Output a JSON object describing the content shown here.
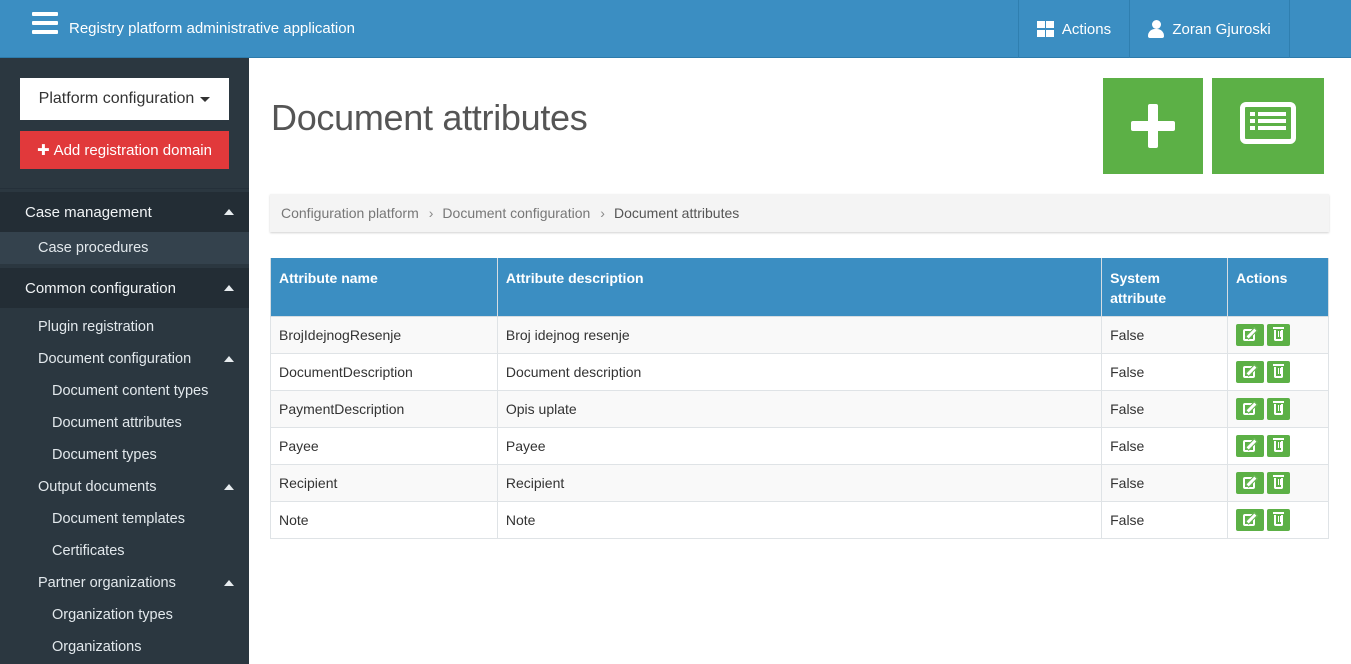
{
  "header": {
    "app_title": "Registry platform administrative application",
    "actions_label": "Actions",
    "user_name": "Zoran Gjuroski"
  },
  "sidebar": {
    "platform_select": "Platform configuration",
    "add_domain": "Add registration domain",
    "items": [
      {
        "label": "Case management",
        "level": 1,
        "expanded": true
      },
      {
        "label": "Case procedures",
        "level": 2
      },
      {
        "label": "Common configuration",
        "level": 1,
        "expanded": true
      },
      {
        "label": "Plugin registration",
        "level": 2
      },
      {
        "label": "Document configuration",
        "level": 2,
        "expanded": true
      },
      {
        "label": "Document content types",
        "level": 3
      },
      {
        "label": "Document attributes",
        "level": 3
      },
      {
        "label": "Document types",
        "level": 3
      },
      {
        "label": "Output documents",
        "level": 2,
        "expanded": true
      },
      {
        "label": "Document templates",
        "level": 3
      },
      {
        "label": "Certificates",
        "level": 3
      },
      {
        "label": "Partner organizations",
        "level": 2,
        "expanded": true
      },
      {
        "label": "Organization types",
        "level": 3
      },
      {
        "label": "Organizations",
        "level": 3
      }
    ]
  },
  "main": {
    "page_title": "Document attributes",
    "breadcrumb": [
      "Configuration platform",
      "Document configuration",
      "Document attributes"
    ],
    "table": {
      "headers": [
        "Attribute name",
        "Attribute description",
        "System attribute",
        "Actions"
      ],
      "rows": [
        [
          "BrojIdejnogResenje",
          "Broj idejnog resenje",
          "False"
        ],
        [
          "DocumentDescription",
          "Document description",
          "False"
        ],
        [
          "PaymentDescription",
          "Opis uplate",
          "False"
        ],
        [
          "Payee",
          "Payee",
          "False"
        ],
        [
          "Recipient",
          "Recipient",
          "False"
        ],
        [
          "Note",
          "Note",
          "False"
        ]
      ]
    }
  },
  "colors": {
    "topbar": "#3b8ec2",
    "sidebar": "#2b3740",
    "accent_green": "#5cb046",
    "accent_red": "#e1393b"
  },
  "icons": [
    "menu-icon",
    "grid-icon",
    "user-icon",
    "plus-icon",
    "list-icon",
    "edit-icon",
    "trash-icon",
    "caret-up-icon",
    "caret-down-icon"
  ]
}
